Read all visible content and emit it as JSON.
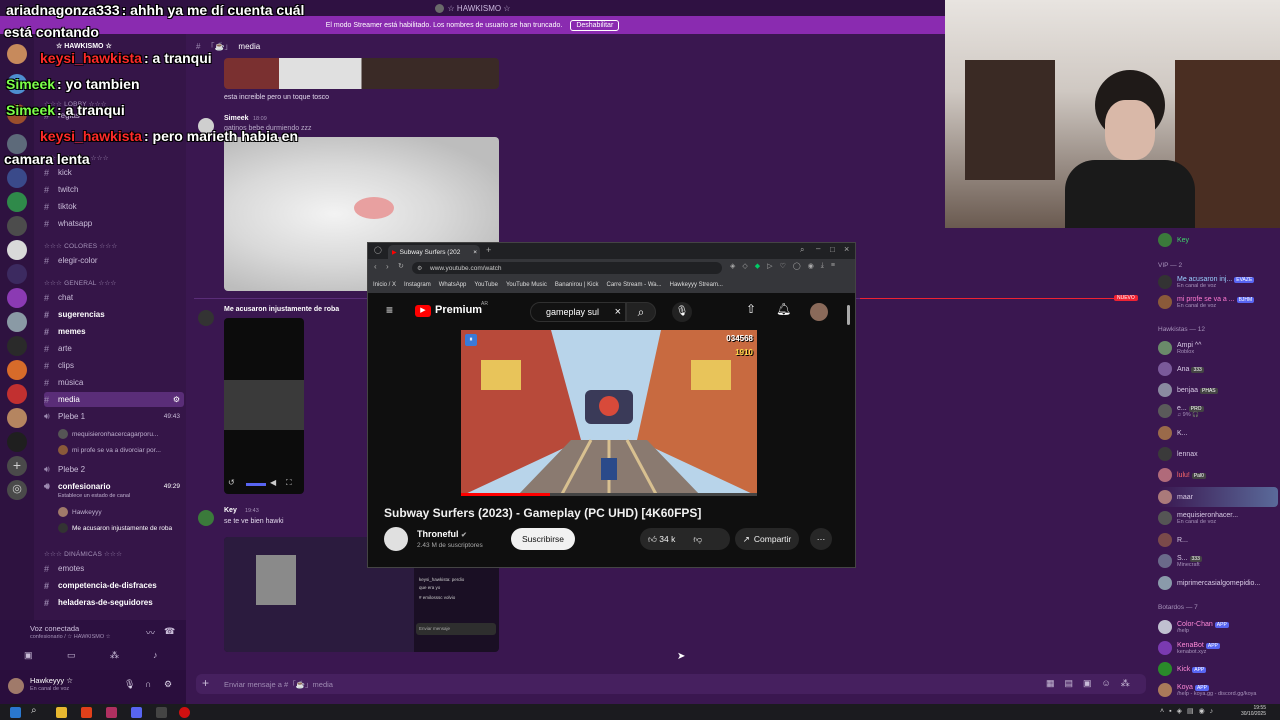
{
  "window": {
    "title": "☆ HAWKISMO ☆"
  },
  "streamer_notice": {
    "text": "El modo Streamer está habilitado. Los nombres de usuario se han truncado.",
    "button": "Deshabilitar"
  },
  "overlay_chat": [
    {
      "name": "ariadnagonza333",
      "text": ": ahhh ya me dí cuenta cuál",
      "color": "#ffffff"
    },
    {
      "name": "",
      "text": "está contando",
      "color": "#ffffff"
    },
    {
      "name": "keysi_hawkista",
      "text": ": a tranqui",
      "color": "#ff2a2a"
    },
    {
      "name": "Simeek",
      "text": ": yo tambien",
      "color": "#7cff4a"
    },
    {
      "name": "Simeek",
      "text": ": a tranqui",
      "color": "#7cff4a"
    },
    {
      "name": "keysi_hawkista",
      "text": ": pero marieth habia en",
      "color": "#ff2a2a"
    },
    {
      "name": "",
      "text": "camara lenta",
      "color": "#ffffff"
    }
  ],
  "server": {
    "name": "☆ HAWKISMO ☆"
  },
  "categories": {
    "lobby": "☆☆☆ LOBBY ☆☆☆",
    "avisos": "☆☆☆ AVISOS ☆☆☆",
    "colores": "☆☆☆ COLORES ☆☆☆",
    "general": "☆☆☆ GENERAL ☆☆☆",
    "dinamicas": "☆☆☆ DINÁMICAS ☆☆☆"
  },
  "channels_top": [
    "reglas"
  ],
  "channels_avisos": [
    "kick",
    "twitch",
    "tiktok",
    "whatsapp"
  ],
  "channels_colores": [
    "elegir-color"
  ],
  "channels_general": [
    "chat",
    "sugerencias",
    "memes",
    "arte",
    "clips",
    "música",
    "media"
  ],
  "voice": {
    "plebe1": "Plebe 1",
    "plebe1_time": "49:43",
    "plebe1_users": [
      "mequisieronhacercagarporu...",
      "mi profe se va a divorciar por..."
    ],
    "plebe2": "Plebe 2",
    "confesionario": "confesionario",
    "confesionario_time": "49:29",
    "confesionario_status": "Establece un estado de canal",
    "confesionario_users": [
      "Hawkeyyy",
      "Me acusaron injustamente de roba"
    ]
  },
  "channels_dinamicas": [
    "emotes",
    "competencia-de-disfraces",
    "heladeras-de-seguidores"
  ],
  "voice_panel": {
    "status": "Voz conectada",
    "location": "confesionario / ☆ HAWKISMO ☆"
  },
  "user_panel": {
    "name": "Hawkeyyy ☆",
    "status": "En canal de voz"
  },
  "chat": {
    "channel": "media",
    "msg1": "esta increible pero un toque tosco",
    "author2": "Simeek",
    "time2": "18:09",
    "msg2": "gatinos bebe durmiendo zzz",
    "thread_title": "Me acusaron injustamente de roba",
    "author3": "Key",
    "time3": "19:43",
    "msg3": "se te ve bien hawki",
    "input_placeholder": "Enviar mensaje a #「☕」media"
  },
  "browser": {
    "tab_title": "Subway Surfers (202",
    "url": "www.youtube.com/watch",
    "bookmarks": [
      "Inicio / X",
      "Instagram",
      "WhatsApp",
      "YouTube",
      "YouTube Music",
      "Bananirou | Kick",
      "Carre Stream - Wa...",
      "Hawkeyyy Stream..."
    ],
    "yt_logo": "Premium",
    "yt_region": "AR",
    "search_value": "gameplay sul",
    "score": "034568",
    "coins": "1910",
    "video_title": "Subway Surfers (2023) - Gameplay (PC UHD) [4K60FPS]",
    "channel": "Throneful",
    "subscribers": "2.43 M de suscriptores",
    "subscribe": "Suscribirse",
    "likes": "34 k",
    "share": "Compartir"
  },
  "members": {
    "top": {
      "name": "Key",
      "status": ""
    },
    "vip_header": "VIP — 2",
    "vip": [
      {
        "name": "Me acusaron inj...",
        "status": "En canal de voz",
        "badge": "EVAZE"
      },
      {
        "name": "mi profe se va a ...",
        "status": "En canal de voz",
        "badge": "BJHM"
      }
    ],
    "hawkistas_header": "Hawkistas — 12",
    "hawkistas": [
      {
        "name": "Ampi ^^",
        "status": "Roblox",
        "badge": ""
      },
      {
        "name": "Ana",
        "status": "",
        "badge": "333"
      },
      {
        "name": "benjaa",
        "status": "",
        "badge": "PHAS"
      },
      {
        "name": "e...",
        "status": "♫ 9% 🎧",
        "badge": "PRO"
      },
      {
        "name": "K...",
        "status": "",
        "badge": ""
      },
      {
        "name": "lennax",
        "status": "",
        "badge": ""
      },
      {
        "name": "lulu!",
        "status": "",
        "badge": "Pal0"
      },
      {
        "name": "maar",
        "status": "",
        "badge": ""
      },
      {
        "name": "mequisieronhacer...",
        "status": "En canal de voz",
        "badge": ""
      },
      {
        "name": "R...",
        "status": "",
        "badge": ""
      },
      {
        "name": "S...",
        "status": "Minecraft",
        "badge": "333"
      },
      {
        "name": "miprimercasialgomepidio...",
        "status": "",
        "badge": ""
      }
    ],
    "bots_header": "Botardos — 7",
    "bots": [
      {
        "name": "Color-Chan",
        "status": "/help",
        "badge": "APP"
      },
      {
        "name": "KenaBot",
        "status": "kenabot.xyz",
        "badge": "APP"
      },
      {
        "name": "Kick",
        "status": "",
        "badge": "APP"
      },
      {
        "name": "Koya",
        "status": "/help - koya.gg - discord.gg/koya",
        "badge": "APP"
      }
    ]
  },
  "new_badge": "NUEVO",
  "clock": {
    "time": "19:55",
    "date": "30/10/2025"
  },
  "embed_preview": {
    "input": "Enviar mensaje",
    "line1": "keysi_hawkista: perdio",
    "line2": "que era yo",
    "line3": "# emilosssc volvio"
  }
}
